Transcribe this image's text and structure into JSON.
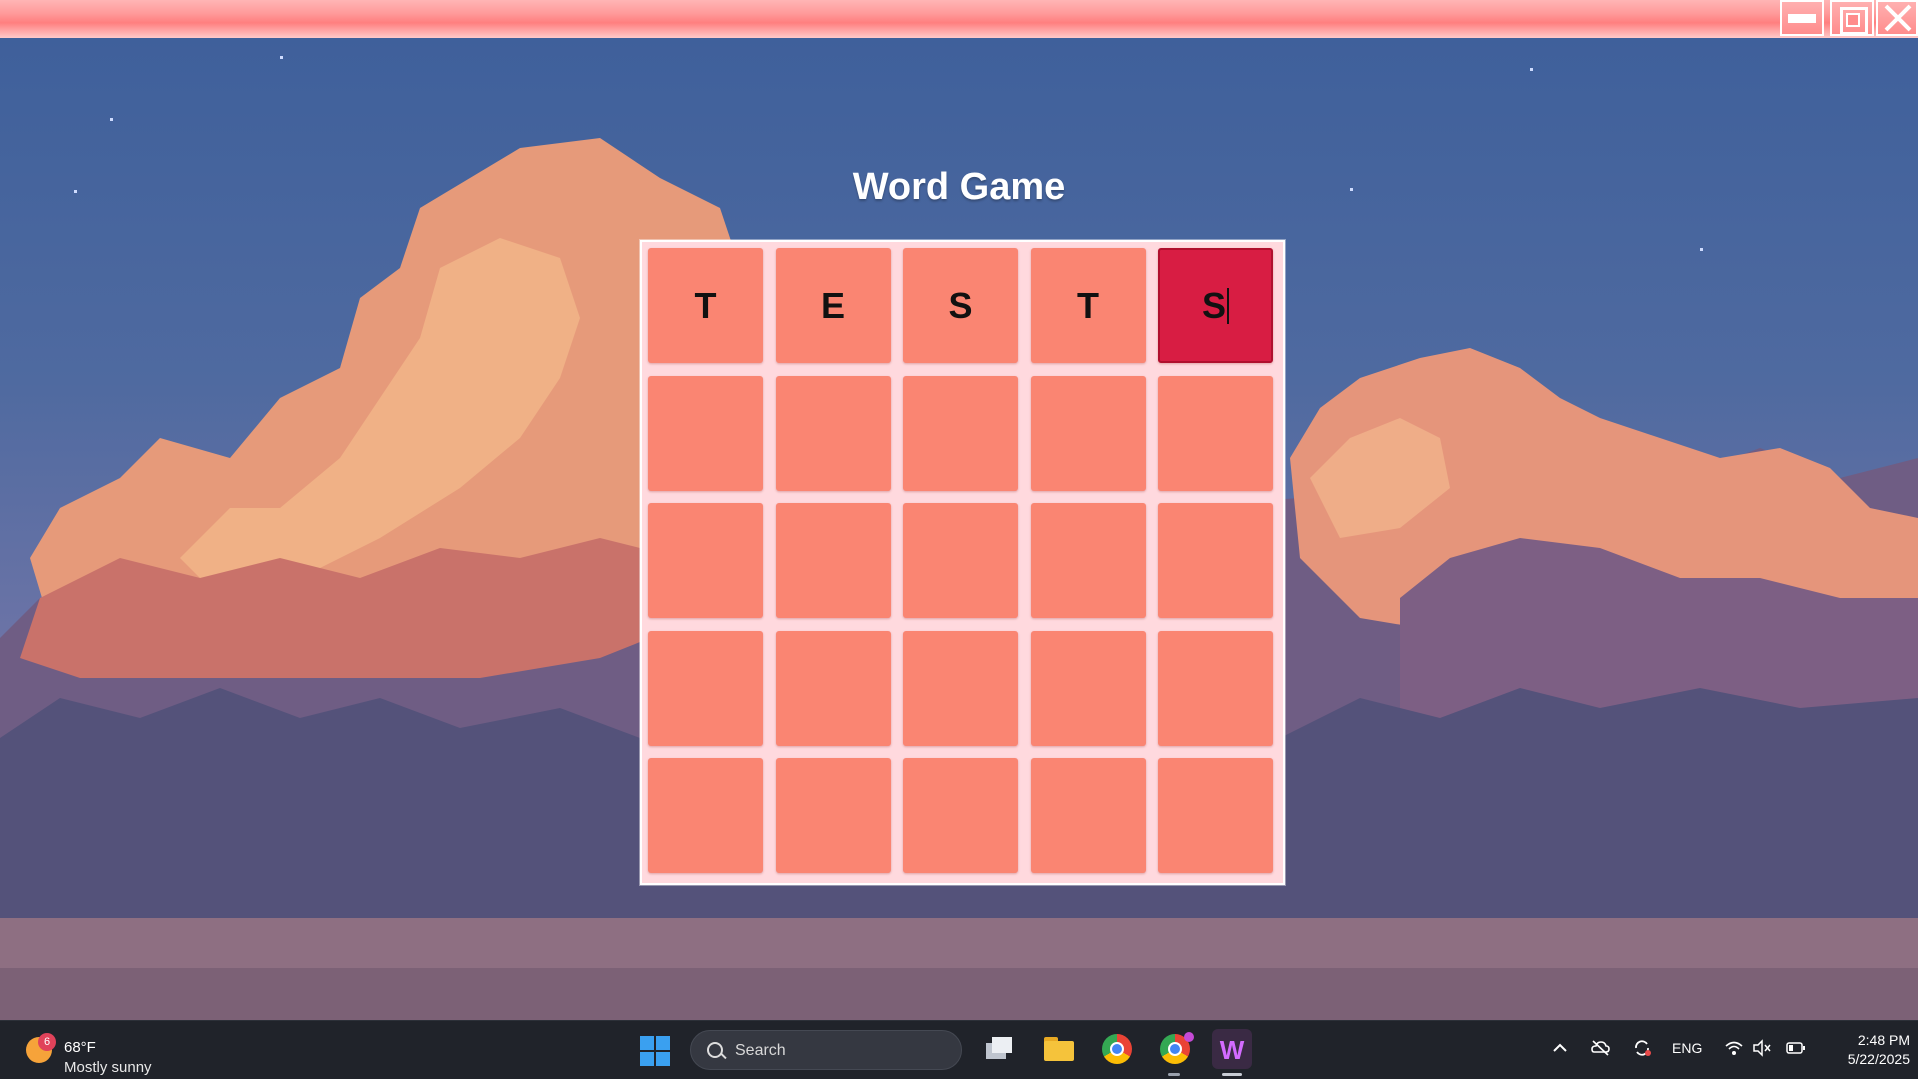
{
  "window": {
    "minimize_icon": "minimize-icon",
    "maximize_icon": "maximize-icon",
    "close_icon": "close-icon",
    "accent_color": "#ff8c8c"
  },
  "game": {
    "title": "Word Game",
    "rows": [
      [
        "T",
        "E",
        "S",
        "T",
        "S"
      ],
      [
        "",
        "",
        "",
        "",
        ""
      ],
      [
        "",
        "",
        "",
        "",
        ""
      ],
      [
        "",
        "",
        "",
        "",
        ""
      ],
      [
        "",
        "",
        "",
        "",
        ""
      ]
    ],
    "active_cell": {
      "row": 0,
      "col": 4
    },
    "colors": {
      "cell": "#fa8572",
      "active_cell": "#d81d43",
      "board": "#ffd9de"
    }
  },
  "taskbar": {
    "weather": {
      "badge": "6",
      "temperature": "68°F",
      "condition": "Mostly sunny"
    },
    "search_placeholder": "Search",
    "apps": [
      "windows-start-icon",
      "task-view-icon",
      "file-explorer-icon",
      "chrome-icon",
      "chrome-profile-icon",
      "word-game-icon"
    ],
    "tray": {
      "language": "ENG"
    },
    "clock": {
      "time": "2:48 PM",
      "date": "5/22/2025"
    }
  }
}
